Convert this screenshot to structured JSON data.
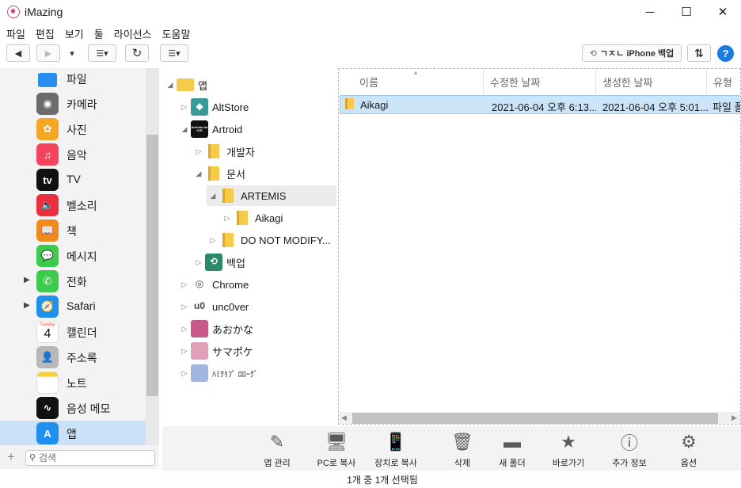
{
  "window": {
    "title": "iMazing",
    "controls": [
      "─",
      "☐",
      "✕"
    ]
  },
  "menu": [
    "파일",
    "편집",
    "보기",
    "툴",
    "라이선스",
    "도움말"
  ],
  "toolbar": {
    "back": "◀",
    "forward": "▶",
    "dropdown": "▾",
    "view_mode": "☰▾",
    "refresh": "↻",
    "sort": "☰▾",
    "backup_label": "ㄱㅈㄴ iPhone 백업",
    "transfer": "⇅",
    "help": "?"
  },
  "sidebar": {
    "items": [
      {
        "label": "파일",
        "icon": "files-icon",
        "glyph": "",
        "color": "#2a8cf0",
        "expand": ""
      },
      {
        "label": "카메라",
        "icon": "camera-icon",
        "glyph": "◉",
        "color": "#6b6b6b",
        "expand": ""
      },
      {
        "label": "사진",
        "icon": "photos-icon",
        "glyph": "✿",
        "color": "#f5a623",
        "expand": ""
      },
      {
        "label": "음악",
        "icon": "music-icon",
        "glyph": "♫",
        "color": "#f2445c",
        "expand": ""
      },
      {
        "label": "TV",
        "icon": "tv-icon",
        "glyph": "tv",
        "color": "#111111",
        "expand": ""
      },
      {
        "label": "벨소리",
        "icon": "ringtone-icon",
        "glyph": "🔈",
        "color": "#e8303f",
        "expand": ""
      },
      {
        "label": "책",
        "icon": "books-icon",
        "glyph": "📖",
        "color": "#f08a1c",
        "expand": ""
      },
      {
        "label": "메시지",
        "icon": "messages-icon",
        "glyph": "💬",
        "color": "#3ccb4a",
        "expand": ""
      },
      {
        "label": "전화",
        "icon": "phone-icon",
        "glyph": "✆",
        "color": "#3ccb4a",
        "expand": "▶"
      },
      {
        "label": "Safari",
        "icon": "safari-icon",
        "glyph": "🧭",
        "color": "#1e90f0",
        "expand": "▶"
      },
      {
        "label": "캘린더",
        "icon": "calendar-icon",
        "glyph": "4",
        "color": "#ffffff",
        "expand": ""
      },
      {
        "label": "주소록",
        "icon": "contacts-icon",
        "glyph": "👤",
        "color": "#b8b8b8",
        "expand": ""
      },
      {
        "label": "노트",
        "icon": "notes-icon",
        "glyph": "",
        "color": "#ffffff",
        "expand": ""
      },
      {
        "label": "음성 메모",
        "icon": "voice-memo-icon",
        "glyph": "∿",
        "color": "#111111",
        "expand": ""
      },
      {
        "label": "앱",
        "icon": "app-store-icon",
        "glyph": "A",
        "color": "#1f8ff0",
        "expand": ""
      }
    ],
    "calendar_day": "Tuesday",
    "search_placeholder": "검색",
    "add": "+"
  },
  "tree": {
    "items": [
      {
        "label": "앱",
        "depth": 0,
        "expand": "◢",
        "icon": "apps-folder-icon",
        "kind": "bigfolder",
        "selected": false
      },
      {
        "label": "AltStore",
        "depth": 1,
        "expand": "▷",
        "icon": "altstore-icon",
        "kind": "app",
        "color": "#3a9a9a",
        "glyph": "◆",
        "selected": false
      },
      {
        "label": "Artroid",
        "depth": 1,
        "expand": "◢",
        "icon": "artroid-icon",
        "kind": "app",
        "color": "#111111",
        "glyph": "Artemis for iOS",
        "selected": false
      },
      {
        "label": "개발자",
        "depth": 2,
        "expand": "▷",
        "icon": "folder-icon",
        "kind": "folder",
        "selected": false
      },
      {
        "label": "문서",
        "depth": 2,
        "expand": "◢",
        "icon": "folder-icon",
        "kind": "folder",
        "selected": false
      },
      {
        "label": "ARTEMIS",
        "depth": 3,
        "expand": "◢",
        "icon": "folder-icon",
        "kind": "folder",
        "selected": true
      },
      {
        "label": "Aikagi",
        "depth": 4,
        "expand": "▷",
        "icon": "folder-icon",
        "kind": "folder",
        "selected": false
      },
      {
        "label": "DO NOT MODIFY...",
        "depth": 3,
        "expand": "▷",
        "icon": "folder-icon",
        "kind": "folder",
        "selected": false
      },
      {
        "label": "백업",
        "depth": 2,
        "expand": "▷",
        "icon": "backup-icon",
        "kind": "app",
        "color": "#2a8a6a",
        "glyph": "⟲",
        "selected": false
      },
      {
        "label": "Chrome",
        "depth": 1,
        "expand": "▷",
        "icon": "chrome-icon",
        "kind": "app",
        "color": "#ffffff",
        "glyph": "◎",
        "selected": false
      },
      {
        "label": "unc0ver",
        "depth": 1,
        "expand": "▷",
        "icon": "unc0ver-icon",
        "kind": "app",
        "color": "#ffffff",
        "glyph": "u0",
        "selected": false
      },
      {
        "label": "あおかな",
        "depth": 1,
        "expand": "▷",
        "icon": "aokana-icon",
        "kind": "app",
        "color": "#c85a8a",
        "glyph": "",
        "selected": false
      },
      {
        "label": "サマポケ",
        "depth": 1,
        "expand": "▷",
        "icon": "summer-pockets-icon",
        "kind": "app",
        "color": "#e0a0b8",
        "glyph": "",
        "selected": false
      },
      {
        "label": "ﾊﾐｸﾘﾌﾟ ﾛﾛｰｸﾞ",
        "depth": 1,
        "expand": "▷",
        "icon": "hamikuri-icon",
        "kind": "app",
        "color": "#a0b8e0",
        "glyph": "",
        "selected": false
      }
    ]
  },
  "files": {
    "columns": [
      "이름",
      "수정한 날짜",
      "생성한 날짜",
      "유형"
    ],
    "rows": [
      {
        "name": "Aikagi",
        "modified": "2021-06-04 오후 6:13...",
        "created": "2021-06-04 오후 5:01...",
        "type": "파일 폴"
      }
    ]
  },
  "actions": [
    {
      "label": "앱 관리",
      "icon": "app-manage-icon",
      "glyph": "✎"
    },
    {
      "label": "PC로 복사",
      "icon": "copy-to-pc-icon",
      "glyph": "🖥"
    },
    {
      "label": "장치로 복사",
      "icon": "copy-to-device-icon",
      "glyph": "📱"
    },
    {
      "label": "삭제",
      "icon": "trash-icon",
      "glyph": "🗑"
    },
    {
      "label": "새 폴더",
      "icon": "new-folder-icon",
      "glyph": "▬"
    },
    {
      "label": "바로가기",
      "icon": "star-icon",
      "glyph": "★"
    },
    {
      "label": "추가 정보",
      "icon": "info-icon",
      "glyph": "ⓘ"
    },
    {
      "label": "옵션",
      "icon": "gear-icon",
      "glyph": "⚙"
    }
  ],
  "status": "1개 중 1개 선택됨"
}
